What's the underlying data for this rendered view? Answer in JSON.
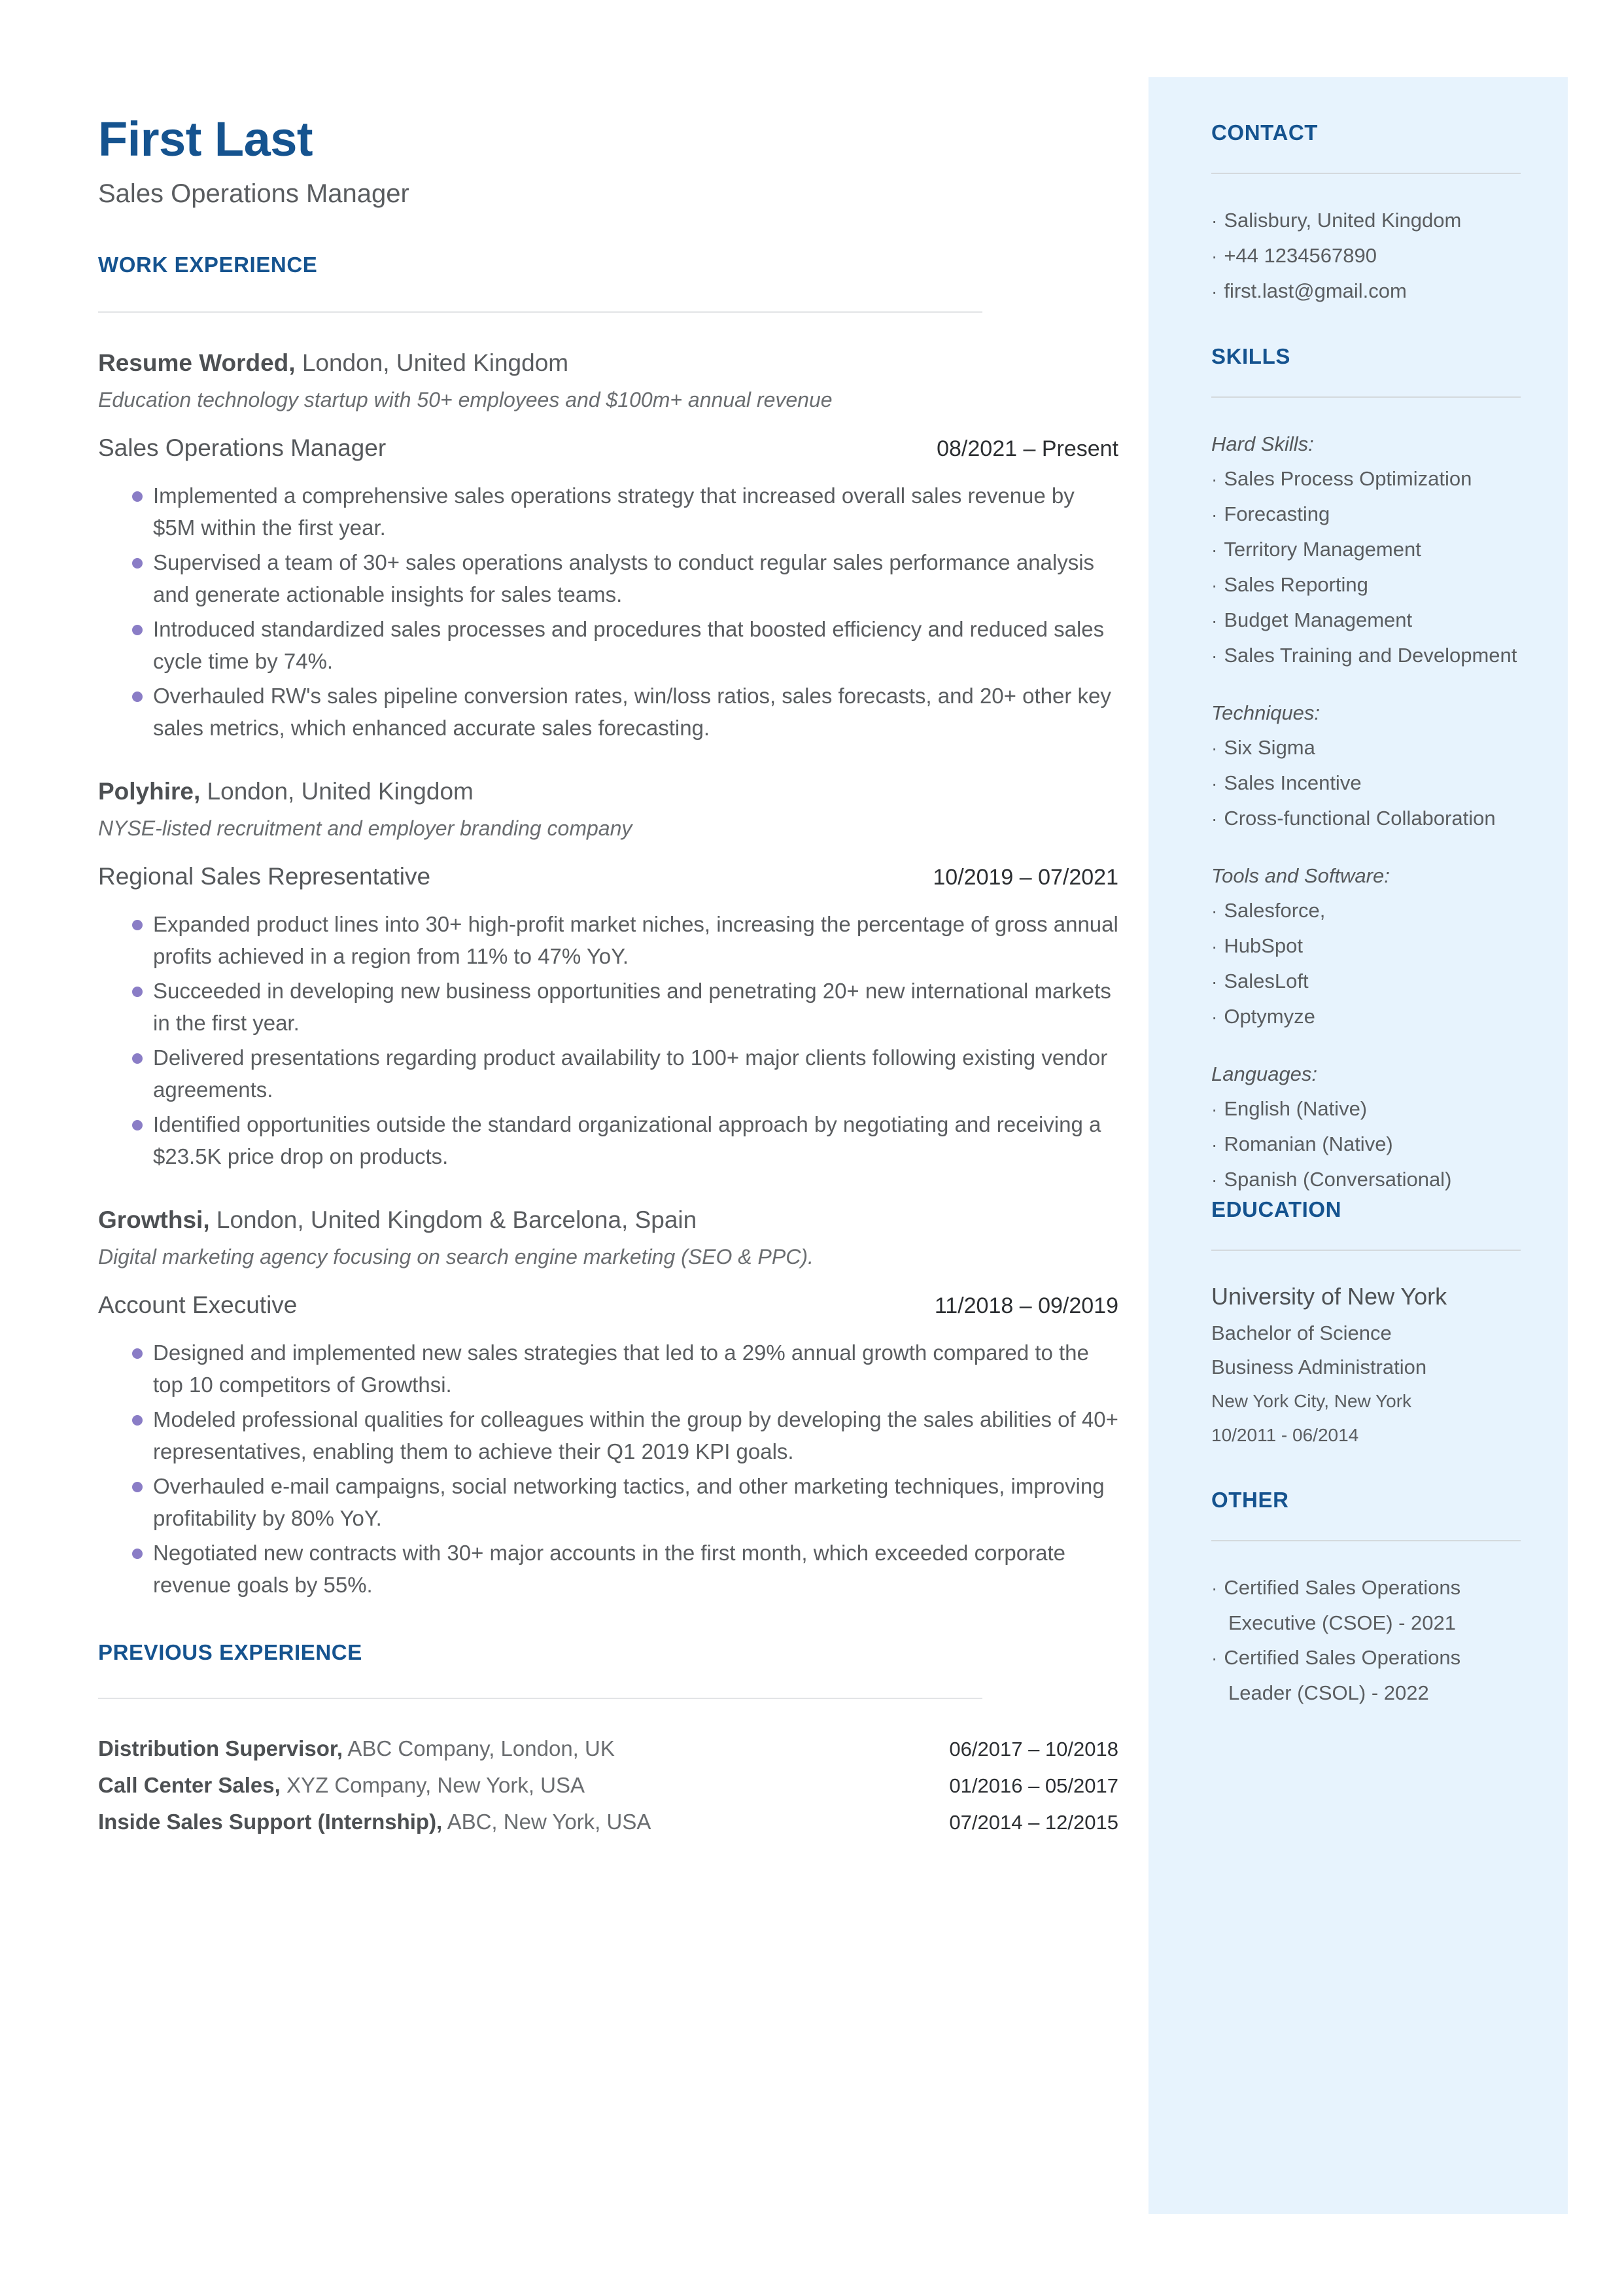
{
  "header": {
    "name": "First Last",
    "role": "Sales Operations Manager"
  },
  "sections": {
    "work_experience": "WORK EXPERIENCE",
    "previous_experience": "PREVIOUS EXPERIENCE",
    "contact": "CONTACT",
    "skills": "SKILLS",
    "education": "EDUCATION",
    "other": "OTHER"
  },
  "jobs": [
    {
      "company_name": "Resume Worded,",
      "company_location": " London, United Kingdom",
      "tagline": "Education technology startup with 50+ employees and $100m+ annual revenue",
      "title": "Sales Operations Manager",
      "dates": "08/2021 – Present",
      "bullets": [
        "Implemented a comprehensive sales operations strategy that increased overall sales revenue by $5M within the first year.",
        "Supervised a team of 30+ sales operations analysts to conduct regular sales performance analysis and generate actionable insights for sales teams.",
        "Introduced standardized sales processes and procedures that boosted efficiency and reduced sales cycle time by 74%.",
        "Overhauled RW's sales pipeline conversion rates, win/loss ratios, sales forecasts, and 20+ other key sales metrics, which enhanced accurate sales forecasting."
      ]
    },
    {
      "company_name": "Polyhire,",
      "company_location": " London, United Kingdom",
      "tagline": "NYSE-listed recruitment and employer branding company",
      "title": "Regional Sales Representative",
      "dates": "10/2019 – 07/2021",
      "bullets": [
        "Expanded product lines into 30+ high-profit market niches, increasing the percentage of gross annual profits achieved in a region from 11% to 47% YoY.",
        "Succeeded in developing new business opportunities and penetrating 20+ new international markets in the first year.",
        "Delivered presentations regarding product availability to 100+ major clients following existing vendor agreements.",
        "Identified opportunities outside the standard organizational approach by negotiating and receiving a $23.5K price drop on products."
      ]
    },
    {
      "company_name": "Growthsi,",
      "company_location": " London, United Kingdom & Barcelona, Spain",
      "tagline": "Digital marketing agency focusing on search engine marketing (SEO & PPC).",
      "title": "Account Executive",
      "dates": "11/2018 – 09/2019",
      "bullets": [
        "Designed and implemented new sales strategies that led to a 29% annual growth compared to the top 10 competitors of Growthsi.",
        "Modeled professional qualities for colleagues within the group by developing the sales abilities of 40+ representatives, enabling them to achieve their Q1 2019 KPI goals.",
        "Overhauled e-mail campaigns, social networking tactics, and other marketing techniques, improving profitability by 80% YoY.",
        "Negotiated new contracts with 30+ major accounts in the first month, which exceeded corporate revenue goals by 55%."
      ]
    }
  ],
  "previous_experience": [
    {
      "title": "Distribution Supervisor,",
      "detail": " ABC Company, London, UK",
      "dates": "06/2017 – 10/2018"
    },
    {
      "title": "Call Center Sales,",
      "detail": " XYZ Company, New York, USA",
      "dates": "01/2016 – 05/2017"
    },
    {
      "title": "Inside Sales Support (Internship),",
      "detail": " ABC, New York, USA",
      "dates": "07/2014 – 12/2015"
    }
  ],
  "contact": {
    "items": [
      "Salisbury, United Kingdom",
      "+44 1234567890",
      "first.last@gmail.com"
    ]
  },
  "skills": {
    "groups": [
      {
        "label": "Hard Skills:",
        "items": [
          "Sales Process Optimization",
          "Forecasting",
          "Territory Management",
          "Sales Reporting",
          "Budget Management",
          "Sales Training and Development"
        ]
      },
      {
        "label": "Techniques:",
        "items": [
          "Six Sigma",
          "Sales Incentive",
          "Cross-functional Collaboration"
        ]
      },
      {
        "label": "Tools and Software:",
        "items": [
          "Salesforce,",
          "HubSpot",
          "SalesLoft",
          "Optymyze"
        ]
      },
      {
        "label": "Languages:",
        "items": [
          "English (Native)",
          "Romanian (Native)",
          "Spanish (Conversational)"
        ]
      }
    ]
  },
  "education": {
    "school": "University of New York",
    "degree": "Bachelor of Science",
    "field": "Business Administration",
    "location": "New York City, New York",
    "dates": "10/2011 - 06/2014"
  },
  "other": {
    "items": [
      "Certified Sales Operations Executive (CSOE) - 2021",
      "Certified Sales Operations Leader (CSOL) - 2022"
    ]
  },
  "colors": {
    "accent_blue": "#15538f",
    "sidebar_bg": "#e7f3fd",
    "bullet_purple": "#8a7dc6",
    "body_gray": "#5a5d60"
  }
}
